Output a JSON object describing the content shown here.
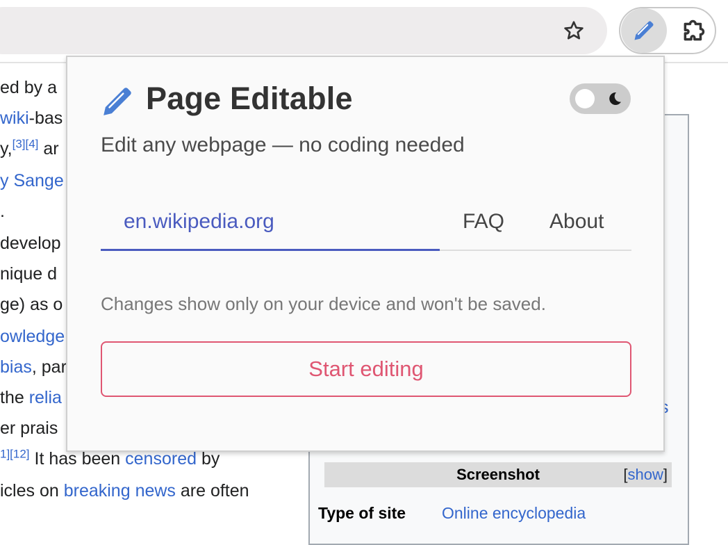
{
  "browser": {
    "bookmark_icon": "star-outline-icon",
    "extensions": [
      {
        "name": "Page Editable",
        "icon": "pencil-icon"
      },
      {
        "name": "Extensions",
        "icon": "puzzle-icon"
      }
    ]
  },
  "wiki": {
    "lines": [
      {
        "parts": [
          {
            "text": "ed by a",
            "link": false
          }
        ]
      },
      {
        "parts": [
          {
            "text": "wiki",
            "link": true
          },
          {
            "text": "-bas",
            "link": false
          }
        ]
      },
      {
        "parts": [
          {
            "text": "y,",
            "link": false
          },
          {
            "text": "[3][4]",
            "link": true,
            "sup": true
          },
          {
            "text": " ar",
            "link": false
          }
        ]
      },
      {
        "parts": [
          {
            "text": "y Sange",
            "link": true
          }
        ]
      },
      {
        "parts": [
          {
            "text": ".",
            "link": false
          }
        ]
      },
      {
        "parts": [
          {
            "text": "develop",
            "link": false
          }
        ]
      },
      {
        "parts": [
          {
            "text": "nique d",
            "link": false
          }
        ]
      },
      {
        "parts": [
          {
            "text": "ge) as o",
            "link": false
          }
        ]
      },
      {
        "parts": [
          {
            "text": "owledge",
            "link": true
          }
        ]
      },
      {
        "parts": [
          {
            "text": "bias",
            "link": true
          },
          {
            "text": ", par",
            "link": false
          }
        ]
      },
      {
        "parts": [
          {
            "text": "the ",
            "link": false
          },
          {
            "text": "relia",
            "link": true
          }
        ]
      },
      {
        "parts": [
          {
            "text": "er prais",
            "link": false
          }
        ]
      },
      {
        "parts": [
          {
            "text": "1][12]",
            "link": true,
            "sup": true
          },
          {
            "text": " It has been ",
            "link": false
          },
          {
            "text": "censored",
            "link": true
          },
          {
            "text": " by",
            "link": false
          }
        ]
      },
      {
        "parts": [
          {
            "text": "icles on ",
            "link": false
          },
          {
            "text": "breaking news",
            "link": true
          },
          {
            "text": " are often",
            "link": false
          }
        ]
      }
    ],
    "infobox": {
      "partial_link": "s",
      "heading": "Screenshot",
      "show_open": "[",
      "show_label": "show",
      "show_close": "]",
      "rows": [
        {
          "label": "Type of site",
          "value": "Online encyclopedia"
        }
      ]
    }
  },
  "popup": {
    "title": "Page Editable",
    "subtitle": "Edit any webpage — no coding needed",
    "theme_toggle": {
      "state": "light",
      "icon": "moon-icon"
    },
    "tabs": [
      {
        "label": "en.wikipedia.org",
        "active": true
      },
      {
        "label": "FAQ",
        "active": false
      },
      {
        "label": "About",
        "active": false
      }
    ],
    "notice": "Changes show only on your device and won't be saved.",
    "start_button": "Start editing",
    "colors": {
      "accent": "#4a5bbf",
      "brand_icon": "#4a7fd4",
      "danger": "#df5672"
    }
  }
}
